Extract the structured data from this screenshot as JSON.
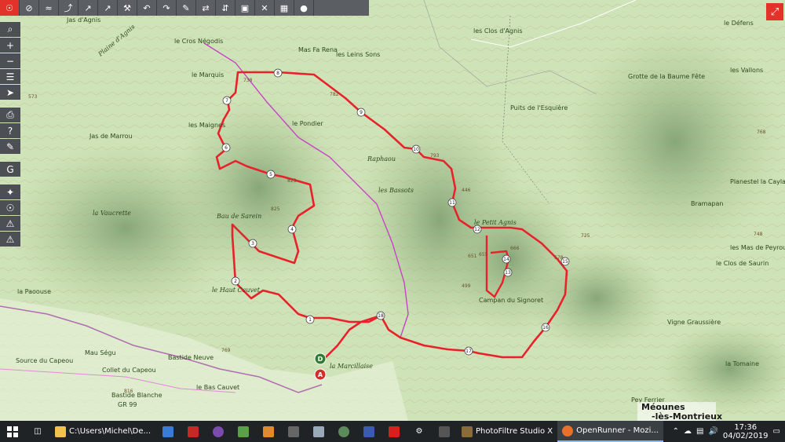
{
  "toolbar": {
    "icons": [
      "gps-icon",
      "hide-icon",
      "wave-icon",
      "route-icon",
      "node-icon",
      "link-icon",
      "bike-icon",
      "undo-icon",
      "redo-icon",
      "edit-icon",
      "flip-icon",
      "split-icon",
      "save-icon",
      "trash-icon",
      "layers-icon",
      "poi-icon"
    ]
  },
  "sidebar": {
    "icons": [
      "zoom-search-icon",
      "zoom-in-icon",
      "zoom-out-icon",
      "layers-icon",
      "locate-icon",
      "print-icon",
      "help-icon",
      "google-icon",
      "compass-icon",
      "globe-icon",
      "warning-icon",
      "warning2-icon"
    ]
  },
  "map": {
    "places": [
      {
        "name": "Plaine d'Agnis"
      },
      {
        "name": "le Cros Négodis"
      },
      {
        "name": "les Clos d'Agnis"
      },
      {
        "name": "Mas Fa Rena"
      },
      {
        "name": "les Leins Sons"
      },
      {
        "name": "le Marquis"
      },
      {
        "name": "les Maignes"
      },
      {
        "name": "le Pondier"
      },
      {
        "name": "Raphaou"
      },
      {
        "name": "les Bassots"
      },
      {
        "name": "le Petit Agnis"
      },
      {
        "name": "la Vaucrette"
      },
      {
        "name": "Bau de Sarein"
      },
      {
        "name": "le Haut Cauvet"
      },
      {
        "name": "la Paoouse"
      },
      {
        "name": "Mau Ségu"
      },
      {
        "name": "Bastide Neuve"
      },
      {
        "name": "Collet du Capeou"
      },
      {
        "name": "Bastide Blanche"
      },
      {
        "name": "le Bas Cauvet"
      },
      {
        "name": "la Marcillaise"
      },
      {
        "name": "Campan du Signoret"
      },
      {
        "name": "Bramapan"
      },
      {
        "name": "Planestel la Caylade"
      },
      {
        "name": "les Mas de Peyrouge"
      },
      {
        "name": "le Clos de Saurin"
      },
      {
        "name": "Vigne Graussière"
      },
      {
        "name": "la Tomaine"
      },
      {
        "name": "Pey Ferrier"
      },
      {
        "name": "les Vallons"
      },
      {
        "name": "le Défens"
      },
      {
        "name": "Grotte de la Baume Fête"
      },
      {
        "name": "Puits de l'Esquière"
      },
      {
        "name": "Source du Capeou"
      },
      {
        "name": "Jas de Marrou"
      },
      {
        "name": "Jas d'Agnis"
      }
    ],
    "town": {
      "line1": "Méounes",
      "line2": "-lès-Montrieux"
    },
    "start_marker": "D",
    "end_marker": "A",
    "waypoints": [
      "1",
      "2",
      "3",
      "4",
      "5",
      "6",
      "7",
      "8",
      "9",
      "10",
      "11",
      "12",
      "13",
      "14",
      "15",
      "16",
      "17",
      "18"
    ],
    "elevations": [
      "738",
      "782",
      "793",
      "825",
      "823",
      "651",
      "446",
      "655",
      "666",
      "578",
      "499",
      "725",
      "748",
      "768",
      "769",
      "816",
      "573"
    ],
    "route_color": "#e8222b",
    "gr_color": "#c744c7",
    "gr_label": "GR 99"
  },
  "taskbar": {
    "explorer_label": "C:\\Users\\Michel\\De...",
    "photofiltre_label": "PhotoFiltre Studio X",
    "openrunner_label": "OpenRunner - Mozi...",
    "time": "17:36",
    "date": "04/02/2019"
  }
}
